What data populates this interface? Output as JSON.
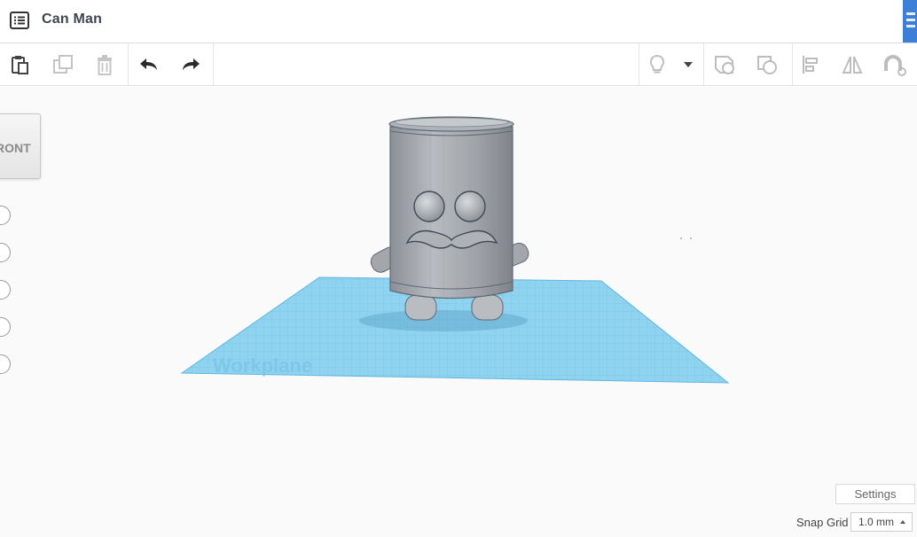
{
  "app": {
    "title": "Can Man"
  },
  "viewcube": {
    "label": "RONT"
  },
  "workplane": {
    "label": "Workplane"
  },
  "settings": {
    "label": "Settings"
  },
  "snap_grid": {
    "label": "Snap Grid",
    "value": "1.0 mm"
  },
  "colors": {
    "accent": "#3c7ed8",
    "workplane": "#8fd3f0",
    "model": "#a4a8ad"
  },
  "icons": {
    "menu": "list-icon",
    "copy": "clipboard-icon",
    "duplicate": "duplicate-icon",
    "delete": "trash-icon",
    "undo": "undo-icon",
    "redo": "redo-icon",
    "light": "lightbulb-icon",
    "group": "group-icon",
    "ungroup": "ungroup-icon",
    "align": "align-icon",
    "mirror": "mirror-icon",
    "magnet": "magnet-icon"
  }
}
